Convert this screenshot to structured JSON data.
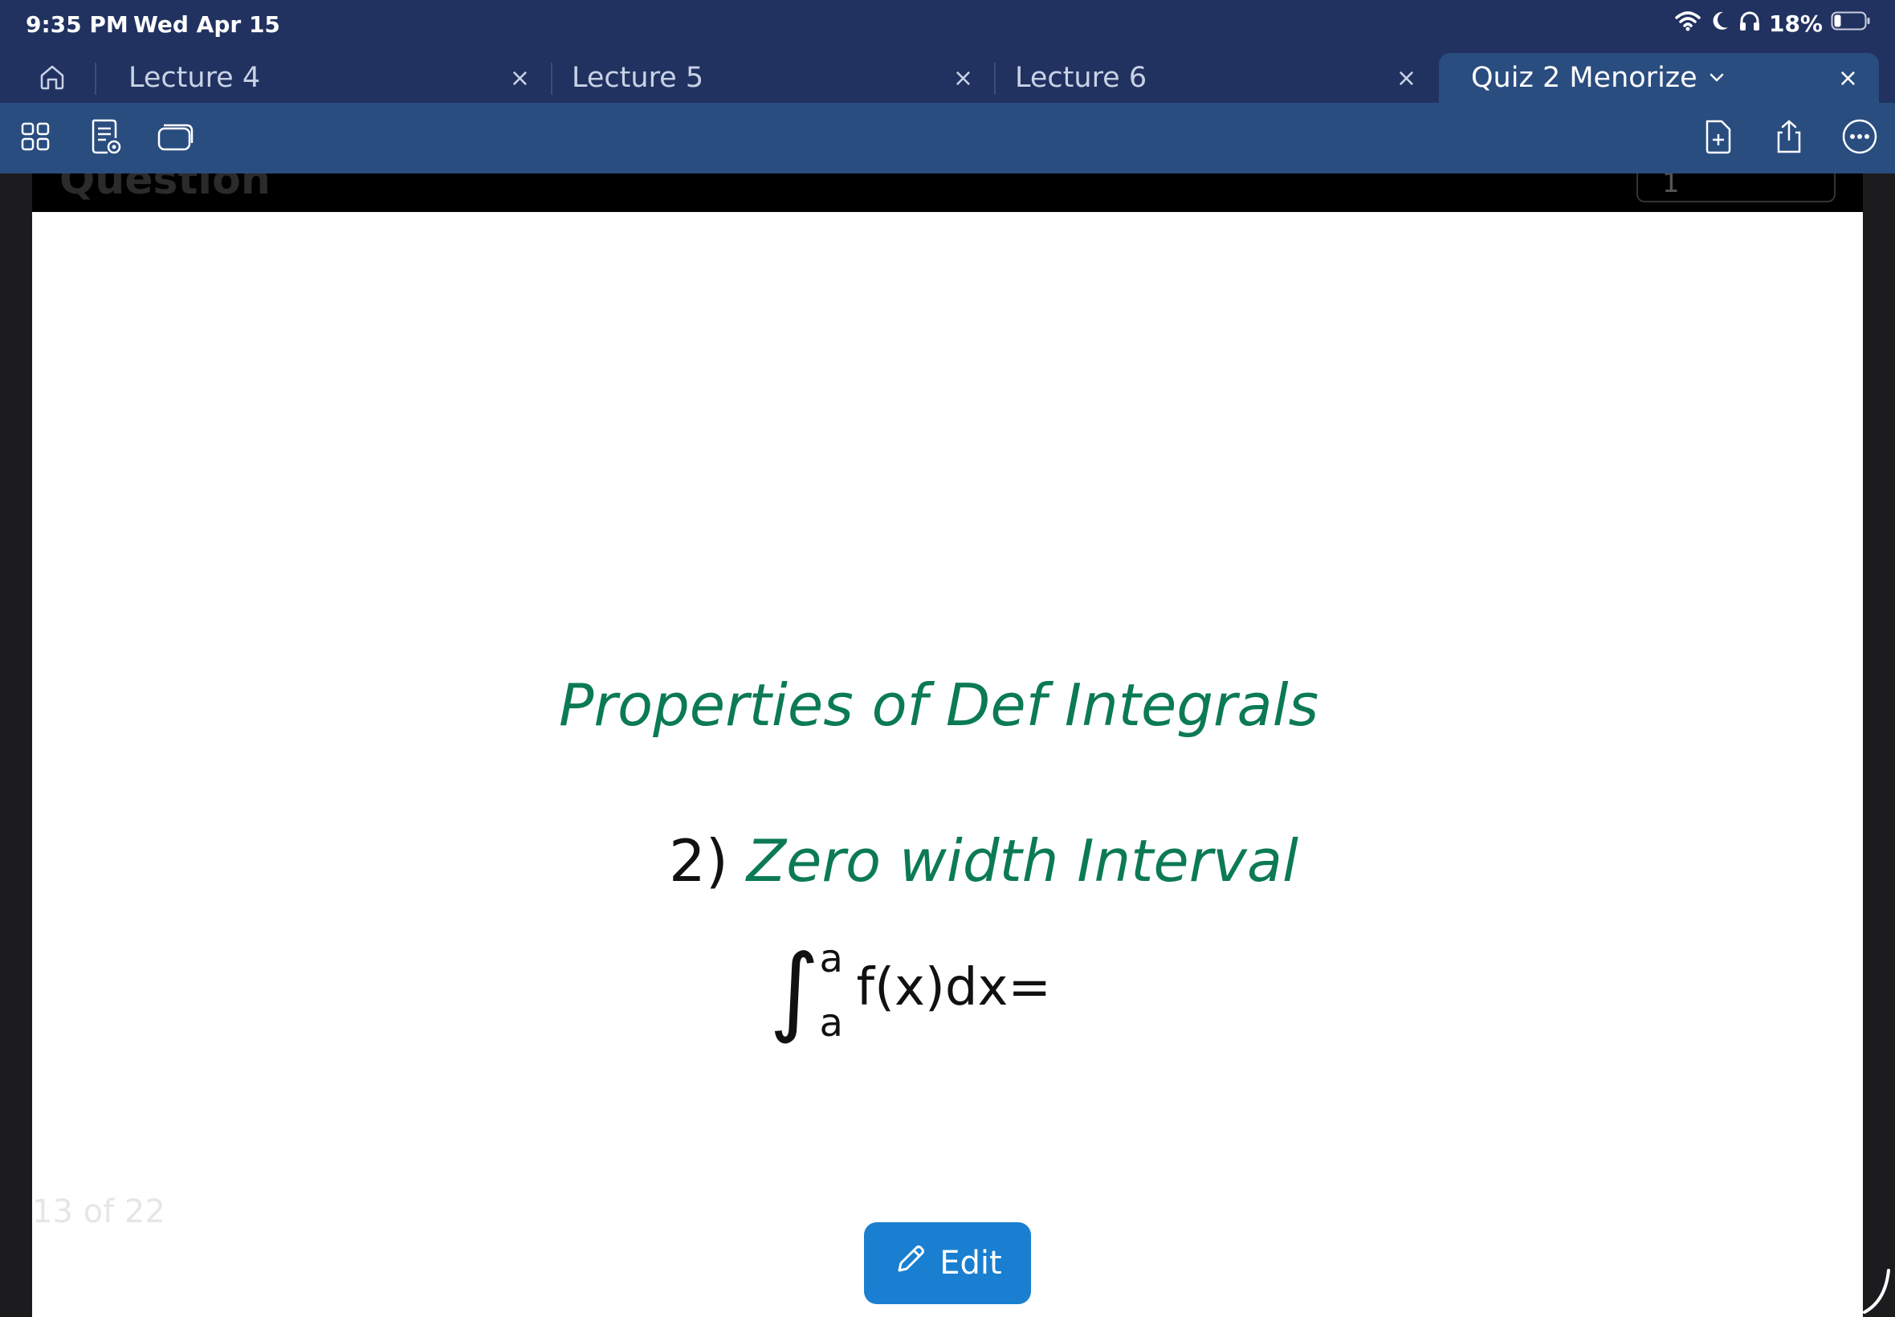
{
  "status_bar": {
    "time": "9:35 PM",
    "date": "Wed Apr 15",
    "battery": "18%"
  },
  "tabs": [
    {
      "label": "Lecture 4",
      "active": false
    },
    {
      "label": "Lecture 5",
      "active": false
    },
    {
      "label": "Lecture 6",
      "active": false
    },
    {
      "label": "Quiz 2 Menorize",
      "active": true
    }
  ],
  "tab_close_glyph": "×",
  "icons": {
    "home": "home-icon",
    "grid": "grid-icon",
    "notes": "notes-icon",
    "windows": "windows-icon",
    "add_page": "add-page-icon",
    "share": "share-icon",
    "more": "more-icon",
    "pencil": "pencil-icon",
    "chevron": "chevron-down-icon"
  },
  "canvas": {
    "header_title": "Question",
    "header_tool_value": "1",
    "page_counter": "13 of 22",
    "note": {
      "title": "Properties of Def Integrals",
      "item_number": "2)",
      "item_text": "Zero width Interval",
      "integral_upper": "a",
      "integral_lower": "a",
      "integrand": "f(x)dx="
    }
  },
  "edit_button": {
    "label": "Edit"
  },
  "colors": {
    "chrome": "#213260",
    "toolbar": "#2a4d80",
    "ink_green": "#0b7a55",
    "edit_blue": "#1a7fd0"
  }
}
